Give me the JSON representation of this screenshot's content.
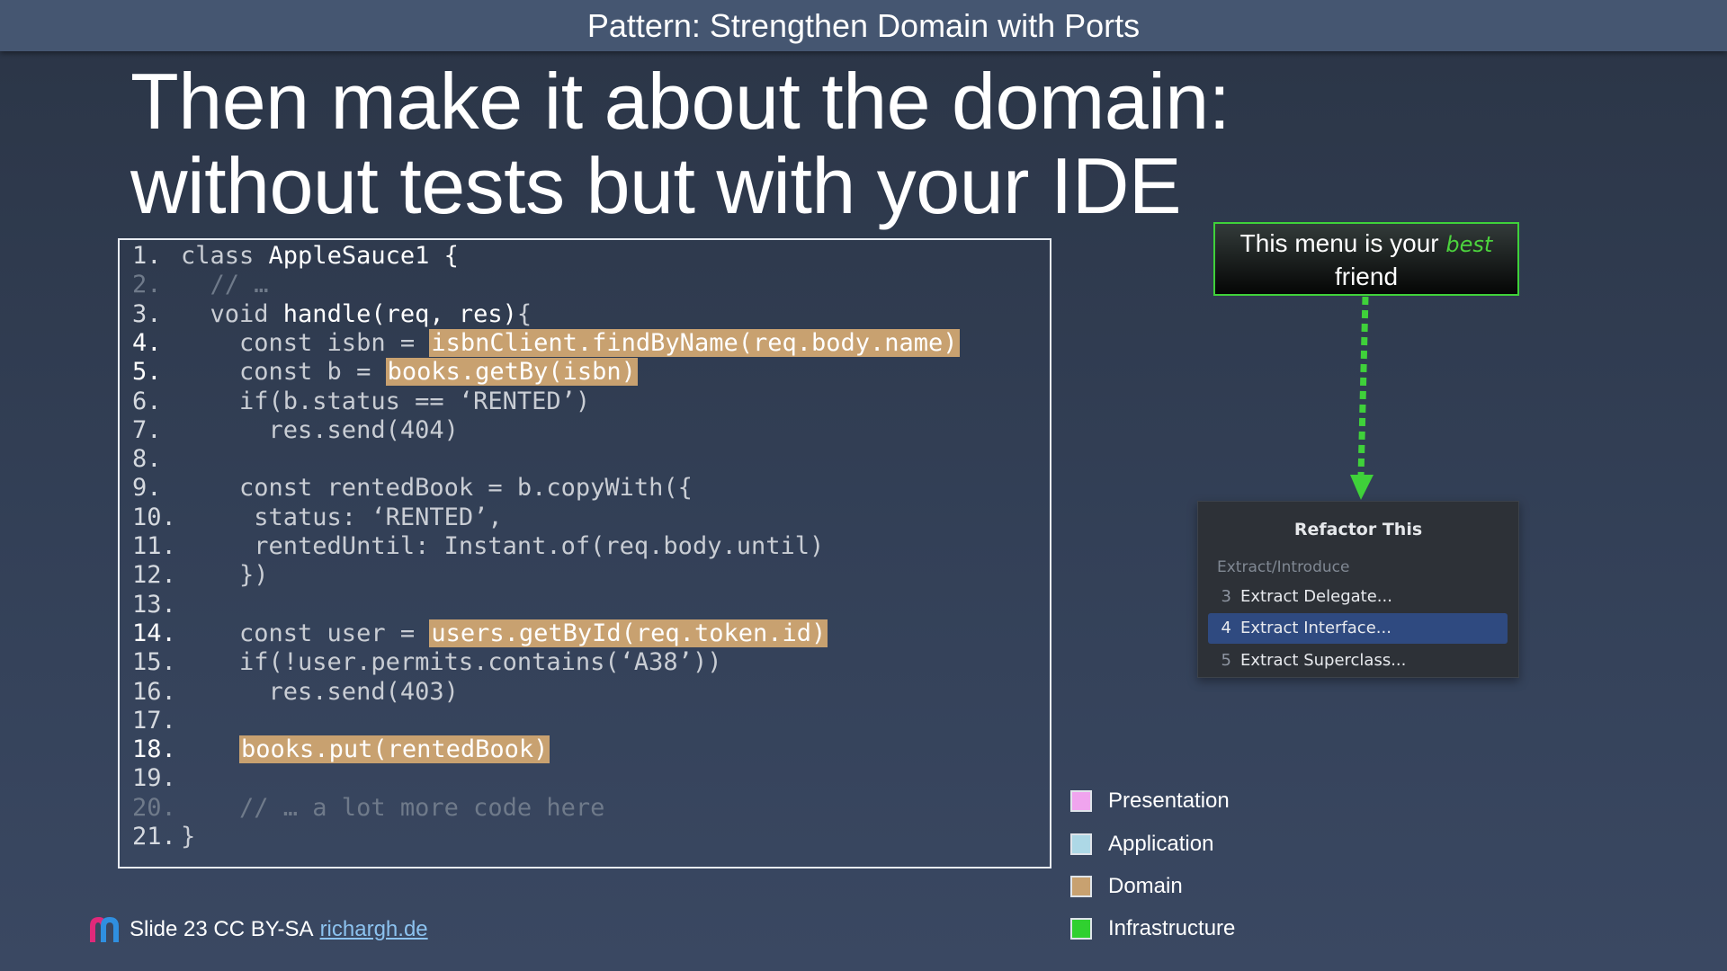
{
  "header": {
    "title": "Pattern: Strengthen Domain with Ports"
  },
  "slide": {
    "title_line1": "Then make it about the domain:",
    "title_line2": "without tests but with your IDE"
  },
  "code": {
    "lines": [
      {
        "num": "1.",
        "pre": "class ",
        "white": "AppleSauce1 {"
      },
      {
        "num": "2.",
        "pre": "  // …"
      },
      {
        "num": "3.",
        "pre": "  void ",
        "white": "handle(req, res)",
        "post": "{"
      },
      {
        "num": "4.",
        "pre": "    const isbn = ",
        "hi": "isbnClient.findByName(req.body.name)"
      },
      {
        "num": "5.",
        "pre": "    const b = ",
        "hi": "books.getBy(isbn)"
      },
      {
        "num": "6.",
        "pre": "    if(b.status == ‘RENTED’)"
      },
      {
        "num": "7.",
        "pre": "      res.send(404)"
      },
      {
        "num": "8.",
        "pre": ""
      },
      {
        "num": "9.",
        "pre": "    const rentedBook = b.copyWith({"
      },
      {
        "num": "10.",
        "pre": "     status: ‘RENTED’,"
      },
      {
        "num": "11.",
        "pre": "     rentedUntil: Instant.of(req.body.until)"
      },
      {
        "num": "12.",
        "pre": "    })"
      },
      {
        "num": "13.",
        "pre": ""
      },
      {
        "num": "14.",
        "pre": "    const user = ",
        "hi": "users.getById(req.token.id)"
      },
      {
        "num": "15.",
        "pre": "    if(!user.permits.contains(‘A38’))"
      },
      {
        "num": "16.",
        "pre": "      res.send(403)"
      },
      {
        "num": "17.",
        "pre": ""
      },
      {
        "num": "18.",
        "pre": "    ",
        "hi": "books.put(rentedBook)"
      },
      {
        "num": "19.",
        "pre": ""
      },
      {
        "num": "20.",
        "pre": "    // … a lot more code here"
      },
      {
        "num": "21.",
        "pre": "}"
      }
    ]
  },
  "callout": {
    "text_before": "This menu is your ",
    "emphasis": "best",
    "text_after": "friend"
  },
  "menu": {
    "title": "Refactor This",
    "section": "Extract/Introduce",
    "items": [
      {
        "key": "3",
        "label": "Extract Delegate..."
      },
      {
        "key": "4",
        "label": "Extract Interface...",
        "selected": true
      },
      {
        "key": "5",
        "label": "Extract Superclass..."
      }
    ]
  },
  "legend": [
    {
      "label": "Presentation",
      "color": "#f0a4ee"
    },
    {
      "label": "Application",
      "color": "#add8e6"
    },
    {
      "label": "Domain",
      "color": "#c8a170"
    },
    {
      "label": "Infrastructure",
      "color": "#30d030"
    }
  ],
  "colors": {
    "highlight": "#c8a170",
    "callout_border": "#3fd13a",
    "menu_selected": "#2f4a80"
  },
  "footer": {
    "text": "Slide 23 CC BY-SA",
    "link": "richargh.de"
  }
}
